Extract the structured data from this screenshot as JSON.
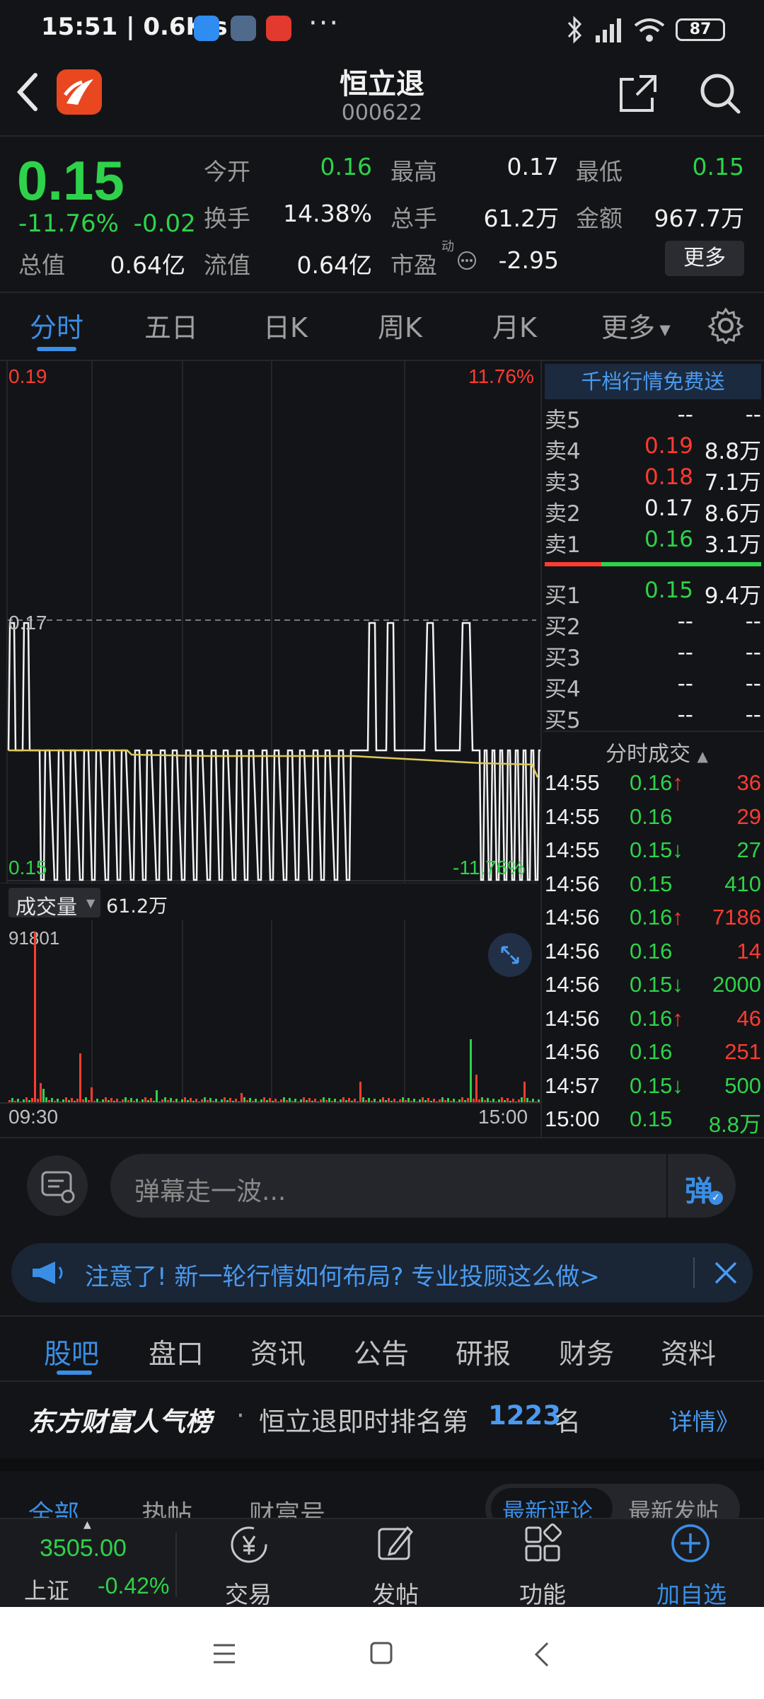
{
  "status": {
    "time": "15:51 | 0.6K/s",
    "dots": "···",
    "battery": "87"
  },
  "header": {
    "title": "恒立退",
    "code": "000622"
  },
  "quote": {
    "price": "0.15",
    "change_pct": "-11.76%",
    "change_abs": "-0.02",
    "open_label": "今开",
    "open": "0.16",
    "high_label": "最高",
    "high": "0.17",
    "low_label": "最低",
    "low": "0.15",
    "turnover_label": "换手",
    "turnover": "14.38%",
    "volume_label": "总手",
    "volume": "61.2万",
    "amount_label": "金额",
    "amount": "967.7万",
    "total_cap_label": "总值",
    "total_cap": "0.64亿",
    "float_cap_label": "流值",
    "float_cap": "0.64亿",
    "pe_label": "市盈",
    "pe_sup": "动",
    "pe": "-2.95",
    "more_label": "更多"
  },
  "chart_tabs": [
    "分时",
    "五日",
    "日K",
    "周K",
    "月K",
    "更多"
  ],
  "chart": {
    "top_price": "0.19",
    "top_pct": "11.76%",
    "mid_price": "0.17",
    "bottom_price": "0.15",
    "bottom_pct": "-11.76%",
    "volume_btn": "成交量",
    "volume_total": "61.2万",
    "volume_max": "91801",
    "time_start": "09:30",
    "time_end": "15:00"
  },
  "orderbook": {
    "banner": "千档行情免费送",
    "asks": [
      {
        "name": "卖5",
        "price": "--",
        "vol": "--",
        "color": "#f0f0f0"
      },
      {
        "name": "卖4",
        "price": "0.19",
        "vol": "8.8万",
        "color": "#ff3b30"
      },
      {
        "name": "卖3",
        "price": "0.18",
        "vol": "7.1万",
        "color": "#ff3b30"
      },
      {
        "name": "卖2",
        "price": "0.17",
        "vol": "8.6万",
        "color": "#f0f0f0"
      },
      {
        "name": "卖1",
        "price": "0.16",
        "vol": "3.1万",
        "color": "#2ed24a"
      }
    ],
    "bids": [
      {
        "name": "买1",
        "price": "0.15",
        "vol": "9.4万",
        "color": "#2ed24a"
      },
      {
        "name": "买2",
        "price": "--",
        "vol": "--",
        "color": "#f0f0f0"
      },
      {
        "name": "买3",
        "price": "--",
        "vol": "--",
        "color": "#f0f0f0"
      },
      {
        "name": "买4",
        "price": "--",
        "vol": "--",
        "color": "#f0f0f0"
      },
      {
        "name": "买5",
        "price": "--",
        "vol": "--",
        "color": "#f0f0f0"
      }
    ],
    "trades_title": "分时成交",
    "trades": [
      {
        "time": "14:55",
        "price": "0.16↑",
        "vol": "36",
        "volcolor": "#ff3b30"
      },
      {
        "time": "14:55",
        "price": "0.16",
        "vol": "29",
        "volcolor": "#ff3b30"
      },
      {
        "time": "14:55",
        "price": "0.15↓",
        "vol": "27",
        "volcolor": "#2ed24a"
      },
      {
        "time": "14:56",
        "price": "0.15",
        "vol": "410",
        "volcolor": "#2ed24a"
      },
      {
        "time": "14:56",
        "price": "0.16↑",
        "vol": "7186",
        "volcolor": "#ff3b30"
      },
      {
        "time": "14:56",
        "price": "0.16",
        "vol": "14",
        "volcolor": "#ff3b30"
      },
      {
        "time": "14:56",
        "price": "0.15↓",
        "vol": "2000",
        "volcolor": "#2ed24a"
      },
      {
        "time": "14:56",
        "price": "0.16↑",
        "vol": "46",
        "volcolor": "#ff3b30"
      },
      {
        "time": "14:56",
        "price": "0.16",
        "vol": "251",
        "volcolor": "#ff3b30"
      },
      {
        "time": "14:57",
        "price": "0.15↓",
        "vol": "500",
        "volcolor": "#2ed24a"
      },
      {
        "time": "15:00",
        "price": "0.15",
        "vol": "8.8万",
        "volcolor": "#2ed24a"
      }
    ]
  },
  "danmu": {
    "placeholder": "弹幕走一波...",
    "btn": "弹"
  },
  "notice": {
    "text": "注意了! 新一轮行情如何布局? 专业投顾这么做>"
  },
  "bottom_tabs": [
    "股吧",
    "盘口",
    "资讯",
    "公告",
    "研报",
    "财务",
    "资料"
  ],
  "rank": {
    "brand": "东方财富人气榜",
    "dot": "·",
    "prefix": "恒立退即时排名第",
    "num": "1223",
    "suffix": "名",
    "detail": "详情》"
  },
  "sub_tabs": {
    "all": "全部",
    "hot": "热帖",
    "wealth": "财富号",
    "latest_comment": "最新评论",
    "latest_post": "最新发帖"
  },
  "bottombar": {
    "index_value": "3505.00",
    "index_name": "上证",
    "index_change": "-0.42%",
    "trade": "交易",
    "post": "发帖",
    "func": "功能",
    "add": "加自选"
  },
  "colors": {
    "up": "#ff3b30",
    "down": "#2ed24a",
    "accent": "#3a8ee6",
    "bg": "#131417"
  }
}
